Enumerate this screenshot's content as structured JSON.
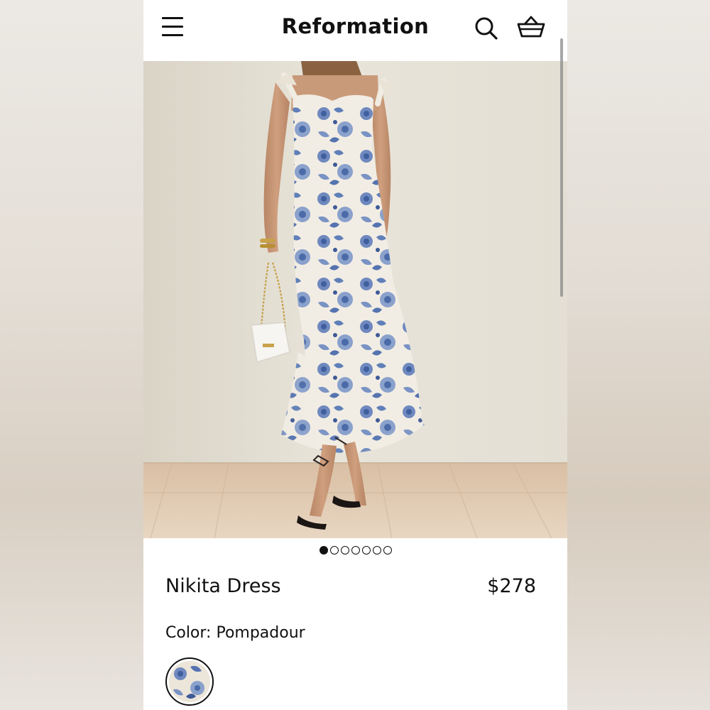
{
  "header": {
    "brand": "Reformation",
    "menu_icon": "menu-icon",
    "search_icon": "search-icon",
    "bag_icon": "shopping-bag-icon"
  },
  "product": {
    "name": "Nikita Dress",
    "price": "$278",
    "color_line": "Color: Pompadour",
    "image_index": 1,
    "image_count": 7
  },
  "colors": {
    "accent": "#111111",
    "print_blue": "#4a6aa8",
    "background": "#ffffff"
  }
}
